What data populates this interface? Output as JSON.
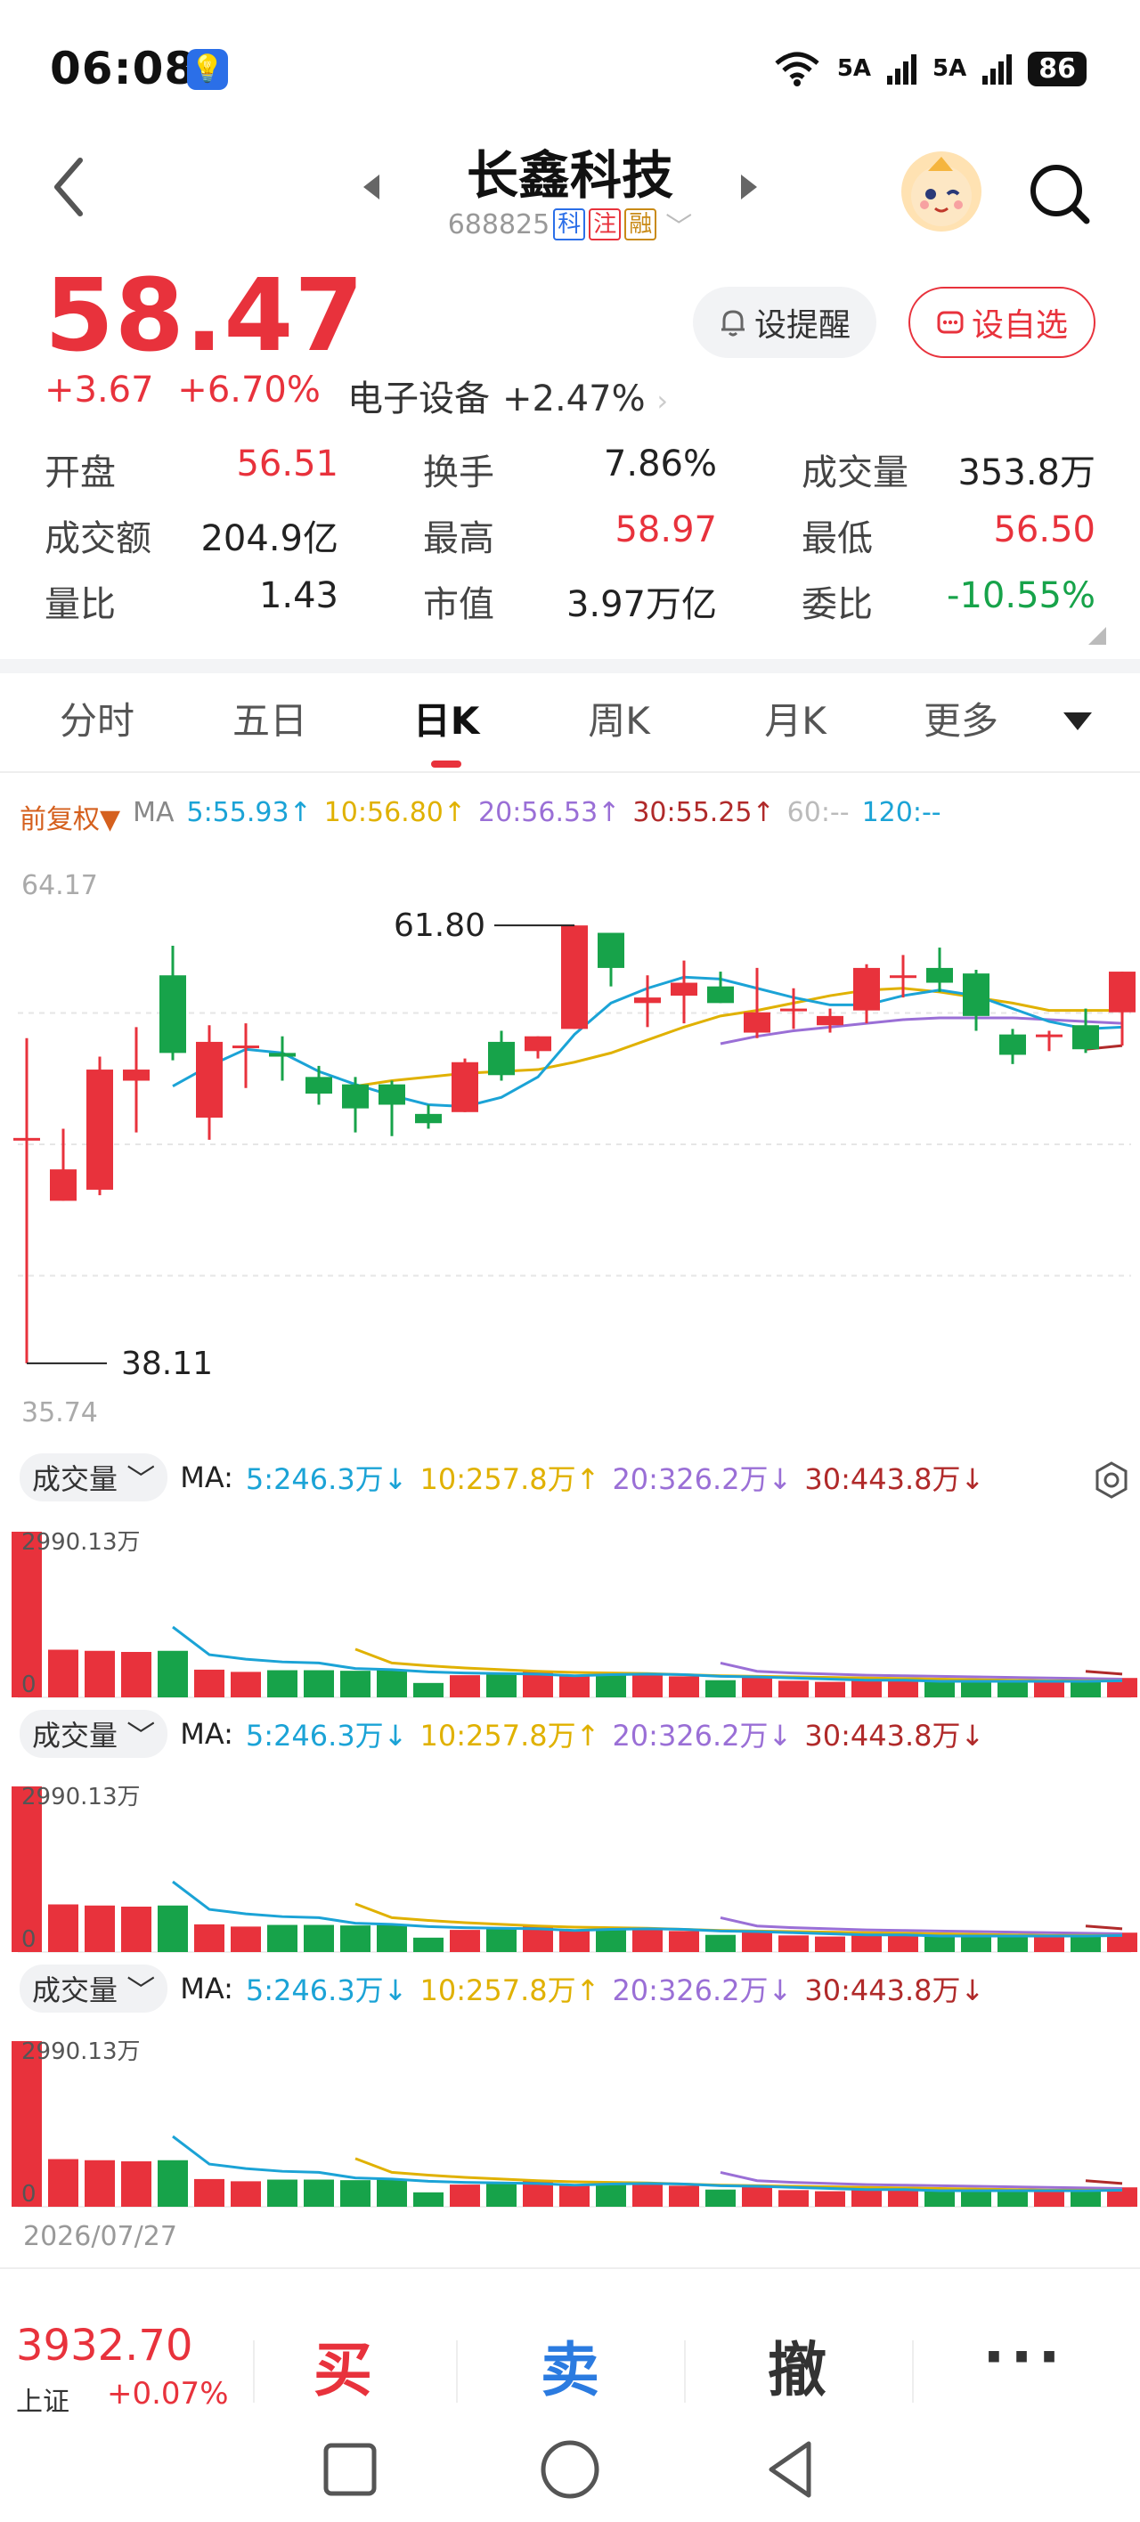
{
  "status_bar": {
    "time": "06:08",
    "net1": "5A",
    "net2": "5A",
    "battery": "86"
  },
  "header": {
    "title": "长鑫科技",
    "code": "688825",
    "tags": [
      "科",
      "注",
      "融"
    ]
  },
  "quote": {
    "price": "58.47",
    "change": "+3.67",
    "change_pct": "+6.70%",
    "sector_name": "电子设备",
    "sector_change": "+2.47%",
    "alert_label": "设提醒",
    "fav_label": "设自选"
  },
  "stats": [
    {
      "label": "开盘",
      "value": "56.51",
      "color": "red"
    },
    {
      "label": "换手",
      "value": "7.86%",
      "color": "dark"
    },
    {
      "label": "成交量",
      "value": "353.8万",
      "color": "dark"
    },
    {
      "label": "成交额",
      "value": "204.9亿",
      "color": "dark"
    },
    {
      "label": "最高",
      "value": "58.97",
      "color": "red"
    },
    {
      "label": "最低",
      "value": "56.50",
      "color": "red"
    },
    {
      "label": "量比",
      "value": "1.43",
      "color": "dark"
    },
    {
      "label": "市值",
      "value": "3.97万亿",
      "color": "dark"
    },
    {
      "label": "委比",
      "value": "-10.55%",
      "color": "green"
    }
  ],
  "tabs": [
    "分时",
    "五日",
    "日K",
    "周K",
    "月K",
    "更多"
  ],
  "active_tab": "日K",
  "ma": {
    "fuquan": "前复权▼",
    "label": "MA",
    "items": [
      {
        "text": "5:55.93↑",
        "color": "#1ba3d6"
      },
      {
        "text": "10:56.80↑",
        "color": "#e0b100"
      },
      {
        "text": "20:56.53↑",
        "color": "#9a6fd6"
      },
      {
        "text": "30:55.25↑",
        "color": "#b02a2a"
      },
      {
        "text": "60:--",
        "color": "#bbbbbb"
      },
      {
        "text": "120:--",
        "color": "#1ba3d6"
      }
    ]
  },
  "colors": {
    "up": "#e8323c",
    "down": "#17a34a",
    "ma5": "#1ba3d6",
    "ma10": "#e0b100",
    "ma20": "#9a6fd6",
    "ma30": "#b02a2a"
  },
  "chart_data": {
    "type": "candlestick",
    "axis_top": "64.17",
    "axis_bottom": "35.74",
    "ylim": [
      35.74,
      64.17
    ],
    "high_label": "61.80",
    "low_label": "38.11",
    "candles": [
      {
        "o": 50.3,
        "c": 50.3,
        "h": 55.7,
        "l": 38.11
      },
      {
        "o": 46.9,
        "c": 48.6,
        "h": 50.8,
        "l": 46.9
      },
      {
        "o": 47.5,
        "c": 54.0,
        "h": 54.7,
        "l": 47.2
      },
      {
        "o": 53.4,
        "c": 54.0,
        "h": 56.3,
        "l": 50.6
      },
      {
        "o": 59.1,
        "c": 54.9,
        "h": 60.7,
        "l": 54.5
      },
      {
        "o": 51.4,
        "c": 55.5,
        "h": 56.4,
        "l": 50.2
      },
      {
        "o": 55.3,
        "c": 55.3,
        "h": 56.5,
        "l": 53.0
      },
      {
        "o": 54.9,
        "c": 54.7,
        "h": 55.8,
        "l": 53.4
      },
      {
        "o": 53.6,
        "c": 52.7,
        "h": 54.2,
        "l": 52.1
      },
      {
        "o": 53.2,
        "c": 51.9,
        "h": 53.6,
        "l": 50.6
      },
      {
        "o": 53.2,
        "c": 52.1,
        "h": 53.4,
        "l": 50.4
      },
      {
        "o": 51.6,
        "c": 51.1,
        "h": 52.1,
        "l": 50.8
      },
      {
        "o": 51.7,
        "c": 54.4,
        "h": 54.6,
        "l": 51.7
      },
      {
        "o": 55.5,
        "c": 53.7,
        "h": 56.1,
        "l": 53.4
      },
      {
        "o": 55.0,
        "c": 55.8,
        "h": 55.8,
        "l": 54.6
      },
      {
        "o": 56.2,
        "c": 61.8,
        "h": 61.8,
        "l": 56.2
      },
      {
        "o": 61.4,
        "c": 59.5,
        "h": 61.4,
        "l": 58.5
      },
      {
        "o": 57.6,
        "c": 57.9,
        "h": 59.1,
        "l": 56.3
      },
      {
        "o": 58.0,
        "c": 58.7,
        "h": 59.9,
        "l": 56.5
      },
      {
        "o": 58.5,
        "c": 57.6,
        "h": 59.3,
        "l": 57.6
      },
      {
        "o": 56.0,
        "c": 57.1,
        "h": 59.5,
        "l": 55.7
      },
      {
        "o": 57.3,
        "c": 57.3,
        "h": 58.4,
        "l": 56.2
      },
      {
        "o": 56.4,
        "c": 56.9,
        "h": 57.3,
        "l": 56.0
      },
      {
        "o": 57.2,
        "c": 59.5,
        "h": 59.7,
        "l": 56.5
      },
      {
        "o": 59.1,
        "c": 59.1,
        "h": 60.2,
        "l": 57.9
      },
      {
        "o": 59.5,
        "c": 58.7,
        "h": 60.6,
        "l": 58.2
      },
      {
        "o": 59.2,
        "c": 56.9,
        "h": 59.4,
        "l": 56.1
      },
      {
        "o": 55.9,
        "c": 54.8,
        "h": 56.2,
        "l": 54.3
      },
      {
        "o": 55.9,
        "c": 55.9,
        "h": 56.1,
        "l": 55.0
      },
      {
        "o": 56.4,
        "c": 55.1,
        "h": 57.3,
        "l": 54.9
      },
      {
        "o": 57.1,
        "c": 59.3,
        "h": 59.3,
        "l": 55.3
      }
    ],
    "ma5": [
      null,
      null,
      null,
      null,
      53.1,
      54.2,
      55.1,
      54.9,
      53.9,
      53.2,
      52.6,
      52.1,
      52.0,
      52.5,
      53.6,
      55.9,
      57.6,
      58.4,
      59.0,
      58.9,
      58.4,
      57.9,
      57.5,
      57.5,
      58.0,
      58.3,
      58.0,
      57.3,
      56.6,
      56.2,
      56.3
    ],
    "ma10": [
      null,
      null,
      null,
      null,
      null,
      null,
      null,
      null,
      null,
      53.1,
      53.4,
      53.6,
      53.8,
      53.9,
      54.0,
      54.4,
      54.9,
      55.6,
      56.3,
      56.9,
      57.2,
      57.6,
      58.0,
      58.3,
      58.4,
      58.2,
      57.9,
      57.6,
      57.2,
      57.2,
      57.2
    ],
    "ma20": [
      null,
      null,
      null,
      null,
      null,
      null,
      null,
      null,
      null,
      null,
      null,
      null,
      null,
      null,
      null,
      null,
      null,
      null,
      null,
      55.4,
      55.8,
      56.1,
      56.3,
      56.5,
      56.7,
      56.8,
      56.8,
      56.8,
      56.7,
      56.6,
      56.5
    ],
    "ma30": [
      null,
      null,
      null,
      null,
      null,
      null,
      null,
      null,
      null,
      null,
      null,
      null,
      null,
      null,
      null,
      null,
      null,
      null,
      null,
      null,
      null,
      null,
      null,
      null,
      null,
      null,
      null,
      null,
      null,
      55.1,
      55.3
    ],
    "volume": {
      "axis_top": "2990.13万",
      "axis_bottom": "0",
      "ymax": 2990.13,
      "values": [
        2990,
        860,
        840,
        820,
        840,
        500,
        460,
        490,
        490,
        480,
        490,
        260,
        400,
        430,
        480,
        380,
        400,
        410,
        380,
        310,
        370,
        300,
        280,
        300,
        290,
        280,
        290,
        300,
        280,
        300,
        350
      ],
      "ma5": [
        null,
        null,
        null,
        null,
        1270,
        770,
        690,
        640,
        620,
        520,
        500,
        460,
        440,
        430,
        420,
        390,
        410,
        420,
        410,
        380,
        370,
        350,
        330,
        310,
        310,
        290,
        290,
        290,
        290,
        290,
        300
      ],
      "ma10": [
        null,
        null,
        null,
        null,
        null,
        null,
        null,
        null,
        null,
        870,
        620,
        570,
        530,
        500,
        470,
        450,
        440,
        430,
        410,
        390,
        380,
        370,
        360,
        350,
        340,
        330,
        320,
        310,
        300,
        300,
        300
      ],
      "ma20": [
        null,
        null,
        null,
        null,
        null,
        null,
        null,
        null,
        null,
        null,
        null,
        null,
        null,
        null,
        null,
        null,
        null,
        null,
        null,
        620,
        470,
        440,
        420,
        400,
        390,
        380,
        370,
        360,
        350,
        340,
        330
      ],
      "ma30": [
        null,
        null,
        null,
        null,
        null,
        null,
        null,
        null,
        null,
        null,
        null,
        null,
        null,
        null,
        null,
        null,
        null,
        null,
        null,
        null,
        null,
        null,
        null,
        null,
        null,
        null,
        null,
        null,
        null,
        470,
        420
      ]
    }
  },
  "volume_panels": [
    {
      "label": "成交量",
      "ma_label": "MA:",
      "items": [
        {
          "text": "5:246.3万↓",
          "color": "#1ba3d6"
        },
        {
          "text": "10:257.8万↑",
          "color": "#e0b100"
        },
        {
          "text": "20:326.2万↓",
          "color": "#9a6fd6"
        },
        {
          "text": "30:443.8万↓",
          "color": "#b02a2a"
        }
      ]
    },
    {
      "label": "成交量",
      "ma_label": "MA:",
      "items": [
        {
          "text": "5:246.3万↓",
          "color": "#1ba3d6"
        },
        {
          "text": "10:257.8万↑",
          "color": "#e0b100"
        },
        {
          "text": "20:326.2万↓",
          "color": "#9a6fd6"
        },
        {
          "text": "30:443.8万↓",
          "color": "#b02a2a"
        }
      ]
    },
    {
      "label": "成交量",
      "ma_label": "MA:",
      "items": [
        {
          "text": "5:246.3万↓",
          "color": "#1ba3d6"
        },
        {
          "text": "10:257.8万↑",
          "color": "#e0b100"
        },
        {
          "text": "20:326.2万↓",
          "color": "#9a6fd6"
        },
        {
          "text": "30:443.8万↓",
          "color": "#b02a2a"
        }
      ]
    }
  ],
  "date_label": "2026/07/27",
  "trade_bar": {
    "index_value": "3932.70",
    "index_name": "上证",
    "index_change": "+0.07%",
    "buy": "买",
    "sell": "卖",
    "cancel": "撤",
    "more": "···"
  }
}
